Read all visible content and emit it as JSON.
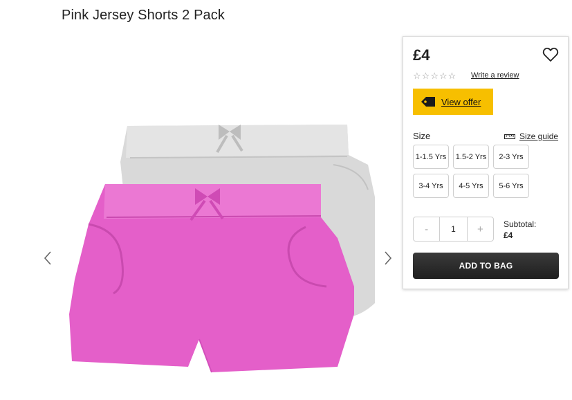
{
  "product": {
    "title": "Pink Jersey Shorts 2 Pack",
    "price": "£4",
    "review_link": "Write a review",
    "rating_stars": 5,
    "offer_label": "View offer",
    "size_label": "Size",
    "size_guide_label": "Size guide",
    "sizes": [
      "1-1.5 Yrs",
      "1.5-2 Yrs",
      "2-3 Yrs",
      "3-4 Yrs",
      "4-5 Yrs",
      "5-6 Yrs"
    ],
    "quantity": "1",
    "minus": "-",
    "plus": "+",
    "subtotal_label": "Subtotal:",
    "subtotal_value": "£4",
    "add_to_bag": "ADD TO BAG"
  },
  "icons": {
    "wishlist": "heart-icon",
    "offer": "tag-icon",
    "size_guide": "ruler-icon",
    "prev": "chevron-left-icon",
    "next": "chevron-right-icon"
  },
  "colors": {
    "offer_yellow": "#f7bf00",
    "button_dark": "#2a2a2a",
    "shorts_pink": "#e45fc9",
    "shorts_grey": "#d7d7d7"
  }
}
